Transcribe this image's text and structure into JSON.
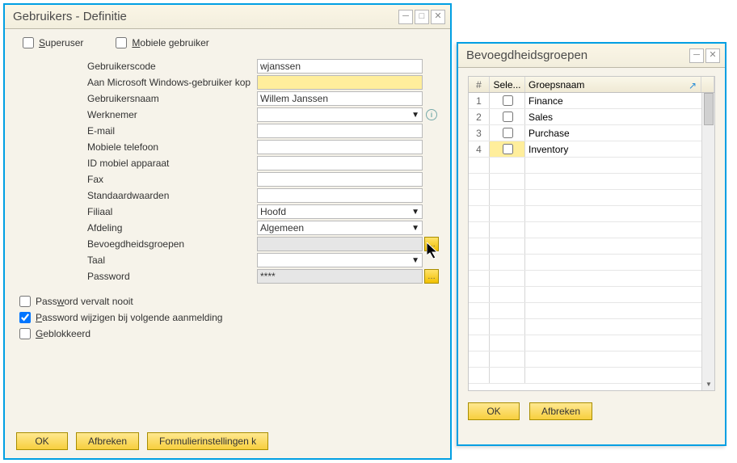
{
  "main": {
    "title": "Gebruikers - Definitie",
    "superuser_label": "Superuser",
    "mobile_user_label": "Mobiele gebruiker",
    "fields": {
      "code_label": "Gebruikerscode",
      "code_value": "wjanssen",
      "winuser_label": "Aan Microsoft Windows-gebruiker kop",
      "winuser_value": "",
      "username_label": "Gebruikersnaam",
      "username_value": "Willem Janssen",
      "employee_label": "Werknemer",
      "employee_value": "",
      "email_label": "E-mail",
      "email_value": "",
      "mobtel_label": "Mobiele telefoon",
      "mobtel_value": "",
      "mobid_label": "ID mobiel apparaat",
      "mobid_value": "",
      "fax_label": "Fax",
      "fax_value": "",
      "defaults_label": "Standaardwaarden",
      "defaults_value": "",
      "branch_label": "Filiaal",
      "branch_value": "Hoofd",
      "dept_label": "Afdeling",
      "dept_value": "Algemeen",
      "authgroups_label": "Bevoegdheidsgroepen",
      "authgroups_value": "",
      "language_label": "Taal",
      "language_value": "",
      "password_label": "Password",
      "password_value": "****"
    },
    "checks": {
      "never_expires": "Password vervalt nooit",
      "change_next": "Password wijzigen bij volgende aanmelding",
      "blocked": "Geblokkeerd"
    },
    "buttons": {
      "ok": "OK",
      "cancel": "Afbreken",
      "formset": "Formulierinstellingen k"
    }
  },
  "popup": {
    "title": "Bevoegdheidsgroepen",
    "cols": {
      "num": "#",
      "sel": "Sele...",
      "name": "Groepsnaam"
    },
    "rows": [
      {
        "n": "1",
        "name": "Finance"
      },
      {
        "n": "2",
        "name": "Sales"
      },
      {
        "n": "3",
        "name": "Purchase"
      },
      {
        "n": "4",
        "name": "Inventory",
        "hi": true
      }
    ],
    "buttons": {
      "ok": "OK",
      "cancel": "Afbreken"
    }
  }
}
